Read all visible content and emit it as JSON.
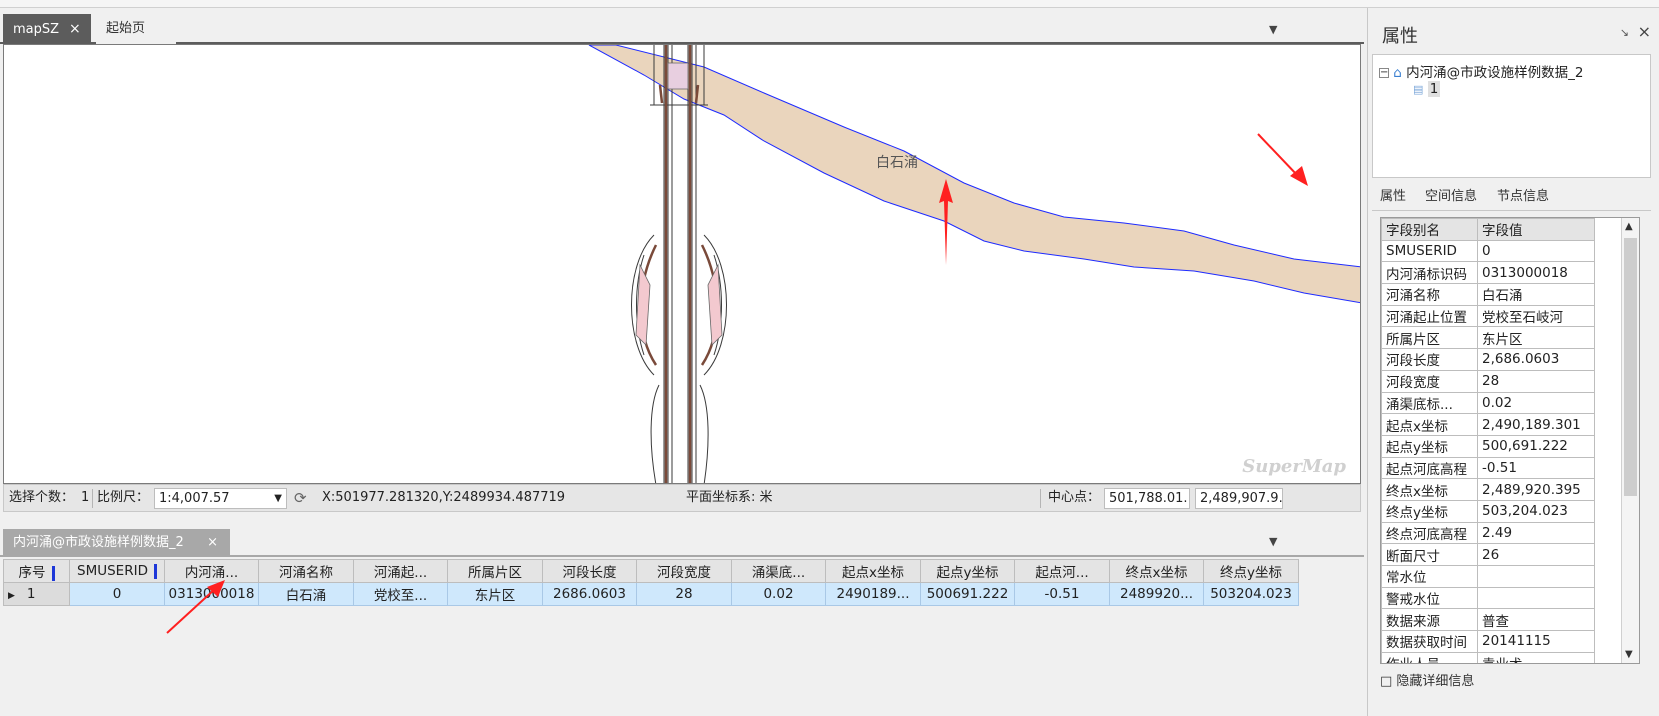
{
  "doc_tabs": [
    {
      "label": "mapSZ",
      "close": "×"
    },
    {
      "label": "起始页"
    }
  ],
  "map": {
    "river_label": "白石涌",
    "watermark": "SuperMap"
  },
  "statusbar": {
    "selected_count_label": "选择个数：",
    "selected_count": "1",
    "scale_label": "比例尺：",
    "scale_value": "1:4,007.57",
    "coords": "X:501977.281320,Y:2489934.487719",
    "coord_system": "平面坐标系: 米",
    "center_label": "中心点：",
    "center_x": "501,788.01...",
    "center_y": "2,489,907.9..."
  },
  "attribute_table": {
    "tab_label": "内河涌@市政设施样例数据_2",
    "tab_close": "×",
    "columns": [
      "序号",
      "SMUSERID",
      "内河涌...",
      "河涌名称",
      "河涌起...",
      "所属片区",
      "河段长度",
      "河段宽度",
      "涌渠底...",
      "起点x坐标",
      "起点y坐标",
      "起点河...",
      "终点x坐标",
      "终点y坐标"
    ],
    "rows": [
      [
        "1",
        "0",
        "0313000018",
        "白石涌",
        "党校至...",
        "东片区",
        "2686.0603",
        "28",
        "0.02",
        "2490189...",
        "500691.222",
        "-0.51",
        "2489920...",
        "503204.023"
      ]
    ]
  },
  "properties_panel": {
    "title": "属性",
    "pin": "↘",
    "close": "×",
    "tree_root": "内河涌@市政设施样例数据_2",
    "tree_child": "1",
    "tabs": [
      "属性",
      "空间信息",
      "节点信息"
    ],
    "header": [
      "字段别名",
      "字段值"
    ],
    "rows": [
      [
        "SMUSERID",
        "0"
      ],
      [
        "内河涌标识码",
        "0313000018"
      ],
      [
        "河涌名称",
        "白石涌"
      ],
      [
        "河涌起止位置",
        "党校至石岐河"
      ],
      [
        "所属片区",
        "东片区"
      ],
      [
        "河段长度",
        "2,686.0603"
      ],
      [
        "河段宽度",
        "28"
      ],
      [
        "涌渠底标...",
        "0.02"
      ],
      [
        "起点x坐标",
        "2,490,189.301"
      ],
      [
        "起点y坐标",
        "500,691.222"
      ],
      [
        "起点河底高程",
        "-0.51"
      ],
      [
        "终点x坐标",
        "2,489,920.395"
      ],
      [
        "终点y坐标",
        "503,204.023"
      ],
      [
        "终点河底高程",
        "2.49"
      ],
      [
        "断面尺寸",
        "26"
      ],
      [
        "常水位",
        ""
      ],
      [
        "警戒水位",
        ""
      ],
      [
        "数据来源",
        "普查"
      ],
      [
        "数据获取时间",
        "20141115"
      ],
      [
        "作业人员",
        "袁业术"
      ]
    ],
    "bottom_text": "□ 隐藏详细信息"
  },
  "colors": {
    "river_fill": "#ead5bd",
    "river_stroke": "#1e2bff",
    "annotation_red": "#ff2020",
    "selected_row": "#cfe8fc",
    "active_tab": "#5c5c5c"
  }
}
